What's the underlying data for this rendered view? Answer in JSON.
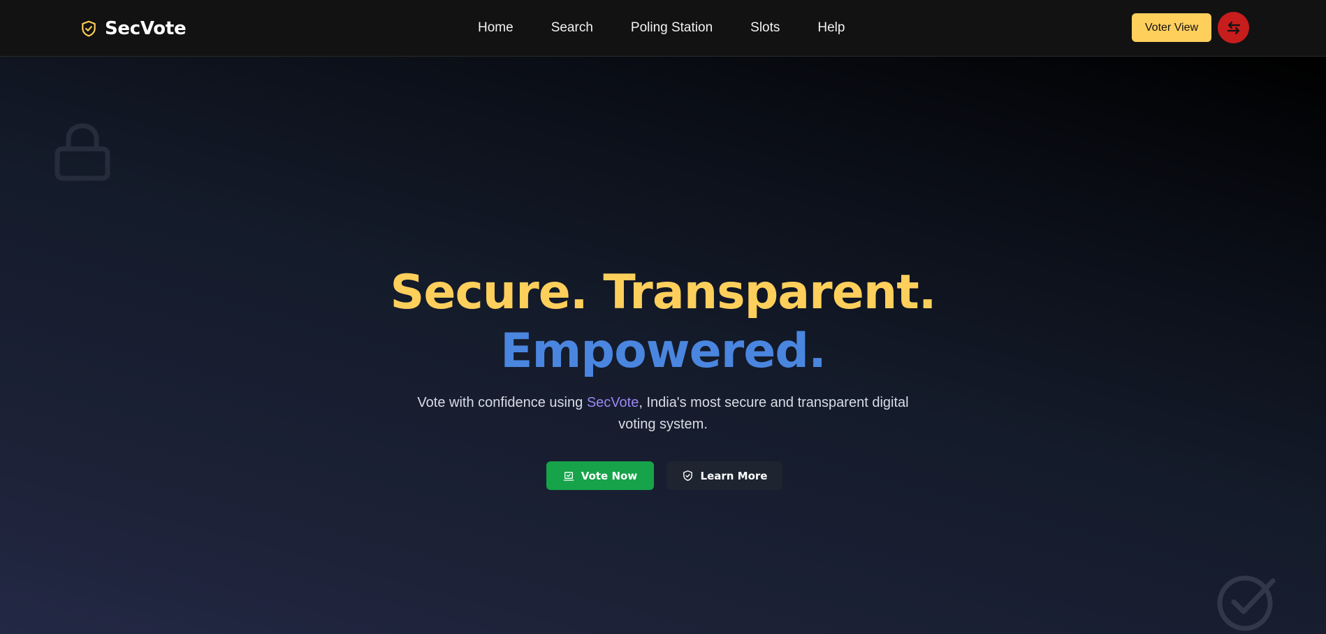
{
  "brand": {
    "name": "SecVote",
    "icon": "shield-check-icon"
  },
  "nav": {
    "links": [
      {
        "label": "Home"
      },
      {
        "label": "Search"
      },
      {
        "label": "Poling Station"
      },
      {
        "label": "Slots"
      },
      {
        "label": "Help"
      }
    ]
  },
  "header_actions": {
    "voter_view_label": "Voter View",
    "switch_icon": "swap-arrows-icon"
  },
  "hero": {
    "headline_line1": "Secure. Transparent.",
    "headline_line2": "Empowered.",
    "subtitle_before": "Vote with confidence using ",
    "subtitle_brand": "SecVote",
    "subtitle_after": ", India's most secure and transparent digital voting system.",
    "primary_button": {
      "label": "Vote Now",
      "icon": "ballot-icon"
    },
    "secondary_button": {
      "label": "Learn More",
      "icon": "shield-icon"
    },
    "decorations": [
      "lock-icon",
      "check-circle-icon"
    ]
  },
  "colors": {
    "accent_yellow": "#ffcf5c",
    "accent_blue": "#4a86df",
    "brand_purple": "#9b87f5",
    "vote_green": "#16a34a",
    "switch_red": "#c71d1d"
  }
}
